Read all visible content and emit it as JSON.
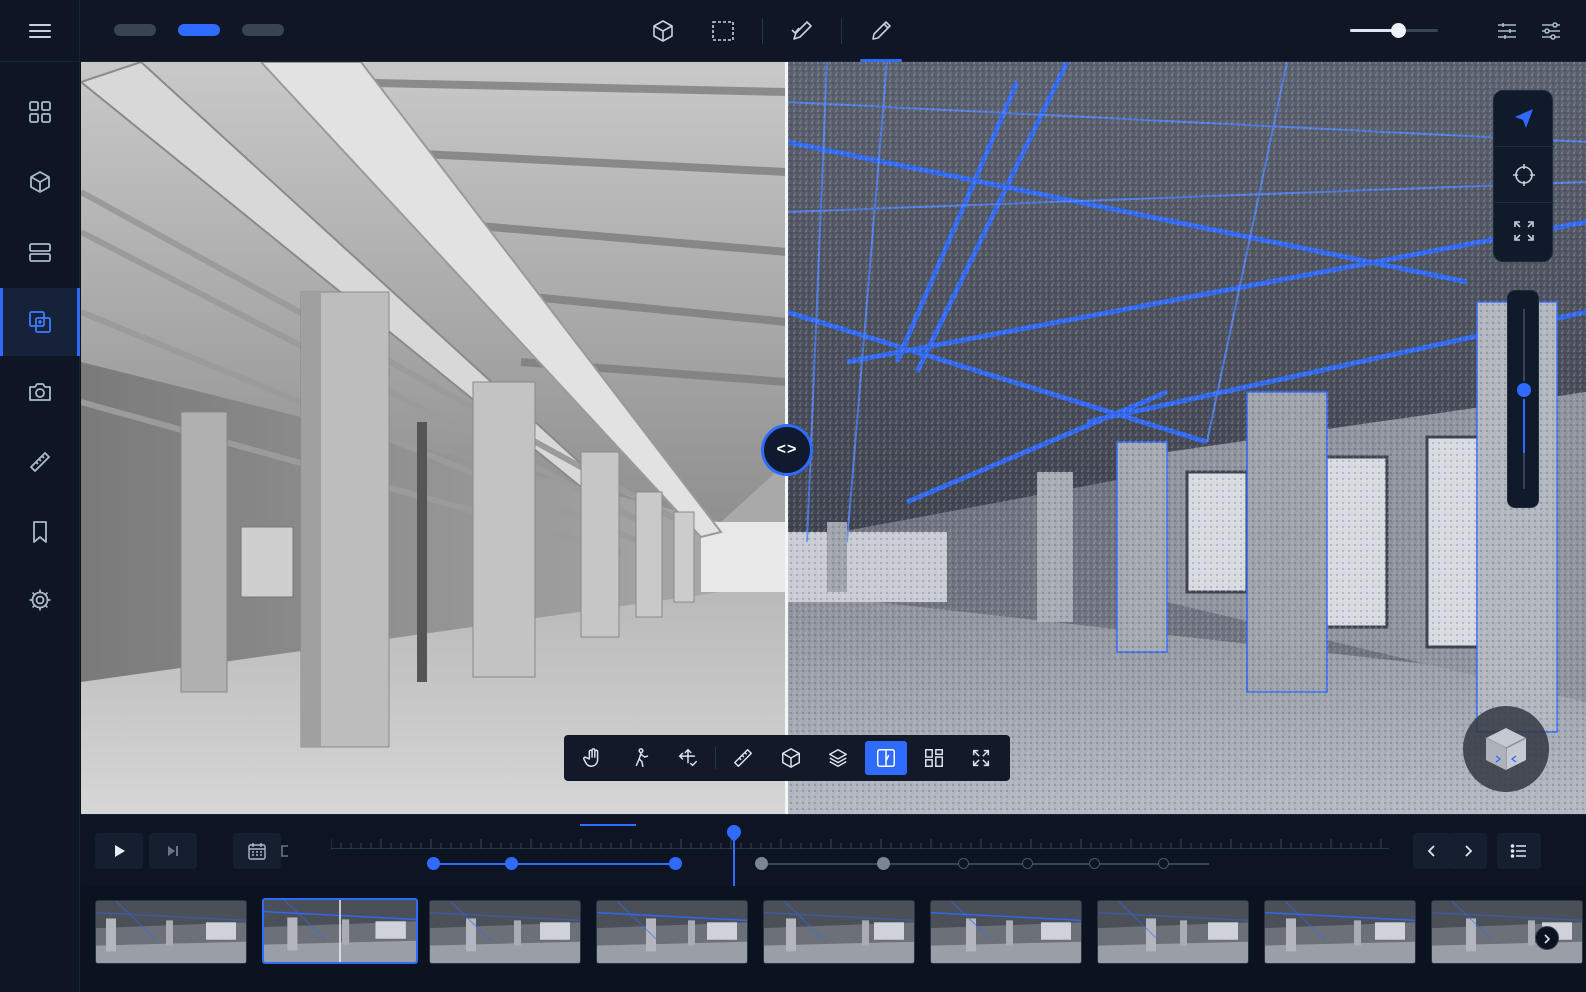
{
  "sidebar": {
    "menu_icon": "hamburger-menu-icon",
    "items": [
      {
        "icon": "grid-icon",
        "active": false
      },
      {
        "icon": "cube-icon",
        "active": false
      },
      {
        "icon": "layers-stack-icon",
        "active": false
      },
      {
        "icon": "compare-overlay-icon",
        "active": true
      },
      {
        "icon": "camera-icon",
        "active": false
      },
      {
        "icon": "ruler-icon",
        "active": false
      },
      {
        "icon": "bookmark-icon",
        "active": false
      },
      {
        "icon": "settings-gear-icon",
        "active": false
      }
    ]
  },
  "topbar": {
    "view_tabs": [
      {
        "active": false
      },
      {
        "active": true
      },
      {
        "active": false
      }
    ],
    "tools": [
      "box-3d-icon",
      "select-rect-icon",
      "annotate-check-icon",
      "pencil-icon"
    ],
    "active_tool": "pencil-icon",
    "zoom_level": 0.55,
    "right_icons": [
      "filter-list-icon",
      "sliders-icon"
    ]
  },
  "viewport": {
    "split_fraction": 0.47,
    "float_nav": [
      "navigate-arrow-icon",
      "orbit-icon",
      "fullscreen-icon"
    ],
    "vertical_slider_level": 0.45,
    "view_cube_icon": "view-cube-icon",
    "toolbar": [
      "hand-pan-icon",
      "walk-icon",
      "pivot-icon",
      "measure-icon",
      "section-box-icon",
      "layers-icon",
      "split-compare-icon",
      "layout-icon",
      "fit-view-icon"
    ],
    "toolbar_active": "split-compare-icon"
  },
  "timeline": {
    "play_icon": "play-icon",
    "step_icon": "step-forward-icon",
    "calendar_icon": "calendar-icon",
    "bracket_icon": "bracket-icon",
    "prev_icon": "chevron-left-icon",
    "next_icon": "chevron-right-icon",
    "list_icon": "list-icon",
    "playhead_fraction": 0.38
  },
  "thumbnails": {
    "count": 9,
    "active_index": 1,
    "next_icon": "chevron-right-icon"
  },
  "colors": {
    "accent": "#2f6bff",
    "background": "#0c1322",
    "panel": "#111a2b"
  }
}
